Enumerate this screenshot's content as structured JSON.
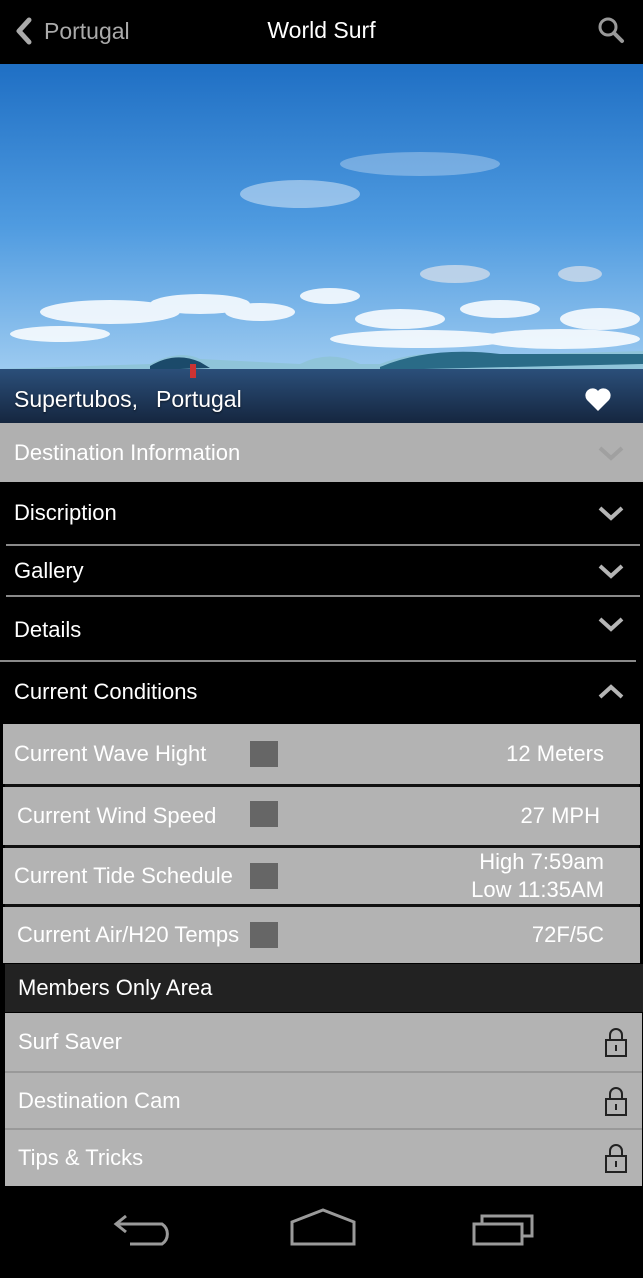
{
  "header": {
    "back_label": "Portugal",
    "title": "World Surf"
  },
  "hero": {
    "spot": "Supertubos,",
    "country": "Portugal"
  },
  "sections": {
    "destination_info": "Destination Information",
    "description": "Discription",
    "gallery": "Gallery",
    "details": "Details",
    "current_conditions": "Current Conditions"
  },
  "conditions": [
    {
      "label": "Current Wave Hight",
      "value": "12 Meters"
    },
    {
      "label": "Current Wind Speed",
      "value": "27 MPH"
    },
    {
      "label": "Current Tide Schedule",
      "value_line1": "High 7:59am",
      "value_line2": "Low 11:35AM"
    },
    {
      "label": "Current Air/H20 Temps",
      "value": "72F/5C"
    }
  ],
  "members": {
    "title": "Members Only Area",
    "items": [
      "Surf Saver",
      "Destination Cam",
      "Tips & Tricks"
    ]
  },
  "icons": {
    "back": "chevron-left-icon",
    "search": "search-icon",
    "favorite": "heart-icon",
    "expand": "chevron-down-icon",
    "collapse": "chevron-up-icon",
    "locked": "lock-icon",
    "nav_back": "back-arrow-icon",
    "nav_home": "home-icon",
    "nav_recent": "recent-apps-icon"
  },
  "colors": {
    "header_bg": "#000000",
    "gray_row": "#b3b3b3",
    "members_head": "#222222",
    "swatch": "#666666"
  }
}
